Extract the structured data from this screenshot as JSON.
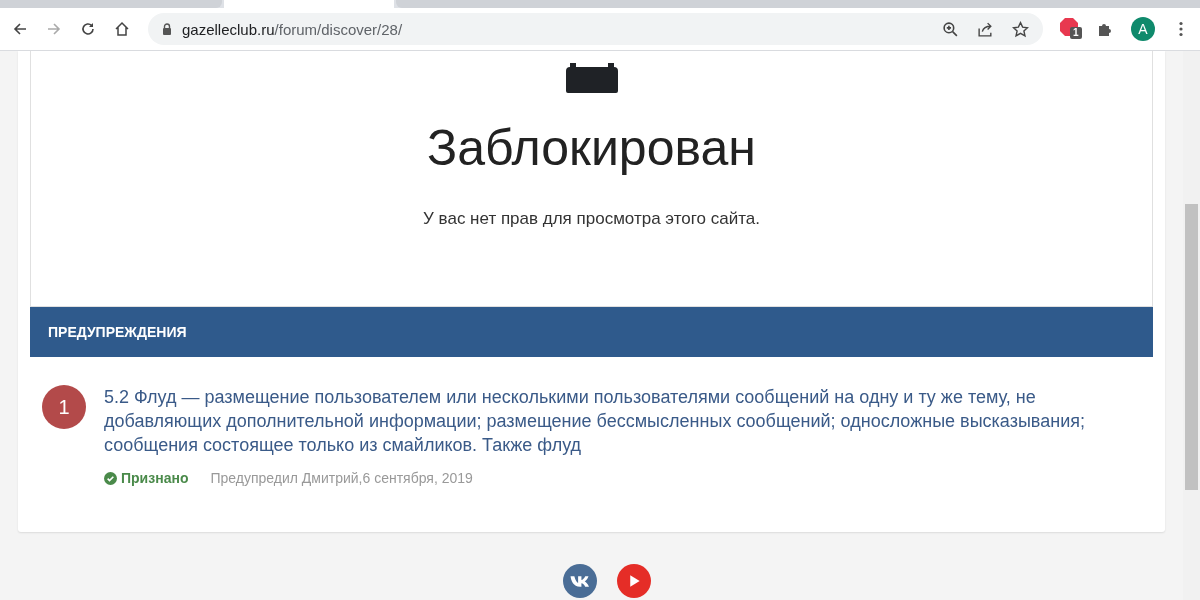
{
  "tabs": [
    {
      "selected": false
    },
    {
      "selected": true
    },
    {
      "selected": false
    }
  ],
  "browser": {
    "url_host": "gazelleclub.ru",
    "url_path": "/forum/discover/28/",
    "extension_badge": "1",
    "profile_initial": "A"
  },
  "blocked": {
    "title": "Заблокирован",
    "message": "У вас нет прав для просмотра этого сайта."
  },
  "warnings": {
    "header": "ПРЕДУПРЕЖДЕНИЯ",
    "items": [
      {
        "points": "1",
        "text": "5.2 Флуд — размещение пользователем или несколькими пользователями сообщений на одну и ту же тему, не добавляющих дополнительной информации; размещение бессмысленных сообщений; односложные высказывания; сообщения состоящее только из смайликов. Также флуд",
        "status": "Признано",
        "acknowledged": true,
        "meta": "Предупредил Дмитрий,6 сентября, 2019"
      }
    ]
  }
}
